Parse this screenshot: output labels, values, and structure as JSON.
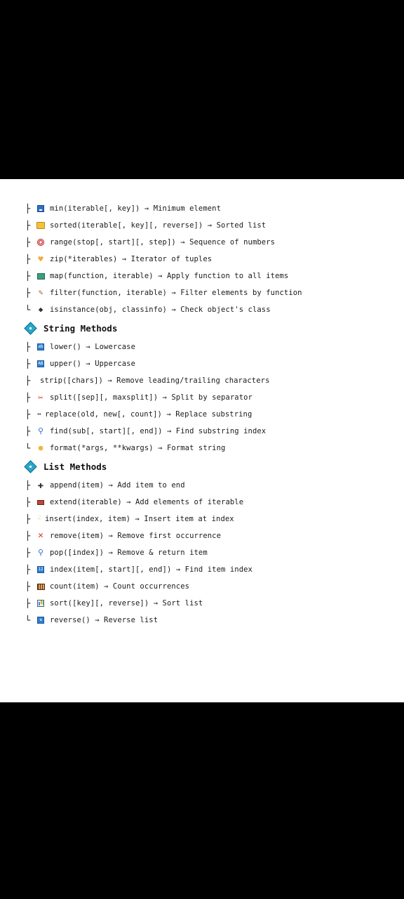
{
  "builtins": [
    {
      "branch": "├",
      "icon": "calendar-icon",
      "text": "min(iterable[, key]) → Minimum element"
    },
    {
      "branch": "├",
      "icon": "folder-icon",
      "text": "sorted(iterable[, key][, reverse]) → Sorted list"
    },
    {
      "branch": "├",
      "icon": "target-icon",
      "text": "range(stop[, start][, step]) → Sequence of numbers"
    },
    {
      "branch": "├",
      "icon": "heart-icon",
      "text": "zip(*iterables) → Iterator of tuples"
    },
    {
      "branch": "├",
      "icon": "book-icon",
      "text": "map(function, iterable) → Apply function to all items"
    },
    {
      "branch": "├",
      "icon": "brush-icon",
      "text": "filter(function, iterable) → Filter elements by function"
    },
    {
      "branch": "└",
      "icon": "graduation-cap-icon",
      "text": "isinstance(obj, classinfo) → Check object's class"
    }
  ],
  "string_section": {
    "title": "String Methods",
    "items": [
      {
        "branch": "├",
        "icon": "lowercase-icon",
        "text": "lower() → Lowercase"
      },
      {
        "branch": "├",
        "icon": "uppercase-icon",
        "text": "upper() → Uppercase"
      },
      {
        "branch": "├",
        "icon": "",
        "text": "strip([chars]) → Remove leading/trailing characters"
      },
      {
        "branch": "├",
        "icon": "scissors-icon",
        "text": "split([sep][, maxsplit]) → Split by separator"
      },
      {
        "branch": "├",
        "icon": "arrows-icon",
        "text": "replace(old, new[, count]) → Replace substring"
      },
      {
        "branch": "├",
        "icon": "magnifier-icon",
        "text": "find(sub[, start][, end]) → Find substring index"
      },
      {
        "branch": "└",
        "icon": "lightbulb-icon",
        "text": "format(*args, **kwargs) → Format string"
      }
    ]
  },
  "list_section": {
    "title": "List Methods",
    "items": [
      {
        "branch": "├",
        "icon": "plus-cross-icon",
        "text": "append(item) → Add item to end"
      },
      {
        "branch": "├",
        "icon": "postbox-icon",
        "text": "extend(iterable) → Add elements of iterable"
      },
      {
        "branch": "├",
        "icon": "pointing-hand-icon",
        "text": "insert(index, item) → Insert item at index"
      },
      {
        "branch": "├",
        "icon": "red-x-icon",
        "text": "remove(item) → Remove first occurrence"
      },
      {
        "branch": "├",
        "icon": "magnifier-icon",
        "text": "pop([index]) → Remove & return item"
      },
      {
        "branch": "├",
        "icon": "numbers-icon",
        "text": "index(item[, start][, end]) → Find item index"
      },
      {
        "branch": "├",
        "icon": "abacus-icon",
        "text": "count(item) → Count occurrences"
      },
      {
        "branch": "├",
        "icon": "bar-chart-icon",
        "text": "sort([key][, reverse]) → Sort list"
      },
      {
        "branch": "└",
        "icon": "reverse-icon",
        "text": "reverse() → Reverse list"
      }
    ]
  },
  "colors": {
    "background": "#000000",
    "sheet": "#ffffff",
    "diamond": "#2aa7c9"
  }
}
